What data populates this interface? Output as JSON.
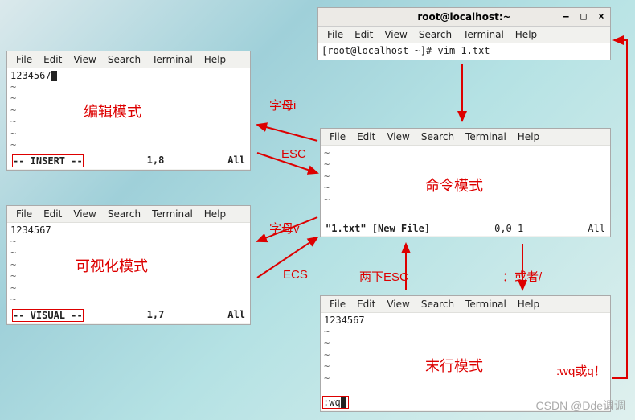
{
  "menus": {
    "file": "File",
    "edit": "Edit",
    "view": "View",
    "search": "Search",
    "terminal": "Terminal",
    "help": "Help"
  },
  "top_window": {
    "title": "root@localhost:~",
    "prompt": "[root@localhost ~]# vim 1.txt"
  },
  "edit_mode": {
    "label": "编辑模式",
    "content": "1234567",
    "status_left": "-- INSERT --",
    "pos": "1,8",
    "scroll": "All"
  },
  "visual_mode": {
    "label": "可视化模式",
    "content": "1234567",
    "status_left": "-- VISUAL --",
    "pos": "1,7",
    "scroll": "All"
  },
  "command_mode": {
    "label": "命令模式",
    "status_left": "\"1.txt\" [New File]",
    "pos": "0,0-1",
    "scroll": "All"
  },
  "last_line_mode": {
    "label": "末行模式",
    "content": "1234567",
    "status_left": ":wq"
  },
  "annotations": {
    "letter_i": "字母i",
    "esc": "ESC",
    "letter_v": "字母v",
    "ecs": "ECS",
    "double_esc": "两下ESC",
    "colon_or_slash": "：或者/",
    "wq_or_q": ":wq或q！"
  },
  "watermark": "CSDN @Dde调调"
}
